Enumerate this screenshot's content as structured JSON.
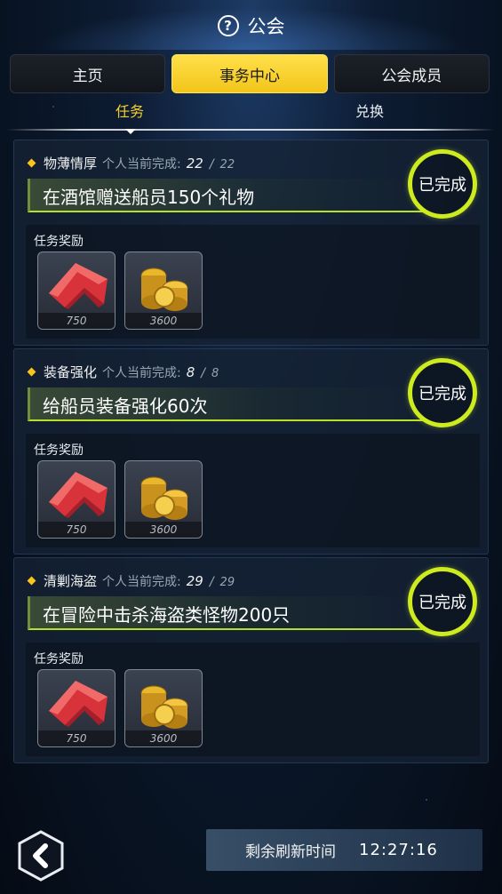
{
  "header": {
    "title": "公会",
    "help_icon": "question-circle-icon"
  },
  "tabs": [
    {
      "label": "主页",
      "active": false
    },
    {
      "label": "事务中心",
      "active": true
    },
    {
      "label": "公会成员",
      "active": false
    }
  ],
  "subtabs": [
    {
      "label": "任务",
      "active": true
    },
    {
      "label": "兑换",
      "active": false
    }
  ],
  "tasks": [
    {
      "name": "物薄情厚",
      "progress_label": "个人当前完成:",
      "progress_current": "22",
      "progress_total": "22",
      "description": "在酒馆赠送船员150个礼物",
      "status": "已完成",
      "rewards_title": "任务奖励",
      "rewards": [
        {
          "icon": "red-chevron-badge-icon",
          "quantity": "750"
        },
        {
          "icon": "gold-coins-icon",
          "quantity": "3600"
        }
      ]
    },
    {
      "name": "装备强化",
      "progress_label": "个人当前完成:",
      "progress_current": "8",
      "progress_total": "8",
      "description": "给船员装备强化60次",
      "status": "已完成",
      "rewards_title": "任务奖励",
      "rewards": [
        {
          "icon": "red-chevron-badge-icon",
          "quantity": "750"
        },
        {
          "icon": "gold-coins-icon",
          "quantity": "3600"
        }
      ]
    },
    {
      "name": "清剿海盗",
      "progress_label": "个人当前完成:",
      "progress_current": "29",
      "progress_total": "29",
      "description": "在冒险中击杀海盗类怪物200只",
      "status": "已完成",
      "rewards_title": "任务奖励",
      "rewards": [
        {
          "icon": "red-chevron-badge-icon",
          "quantity": "750"
        },
        {
          "icon": "gold-coins-icon",
          "quantity": "3600"
        }
      ]
    }
  ],
  "footer": {
    "back_icon": "chevron-left-icon",
    "refresh_label": "剩余刷新时间",
    "refresh_time": "12:27:16"
  },
  "colors": {
    "accent_yellow": "#f7d12b",
    "complete_ring": "#cdeb1e",
    "desc_underline": "#b8e02a"
  }
}
